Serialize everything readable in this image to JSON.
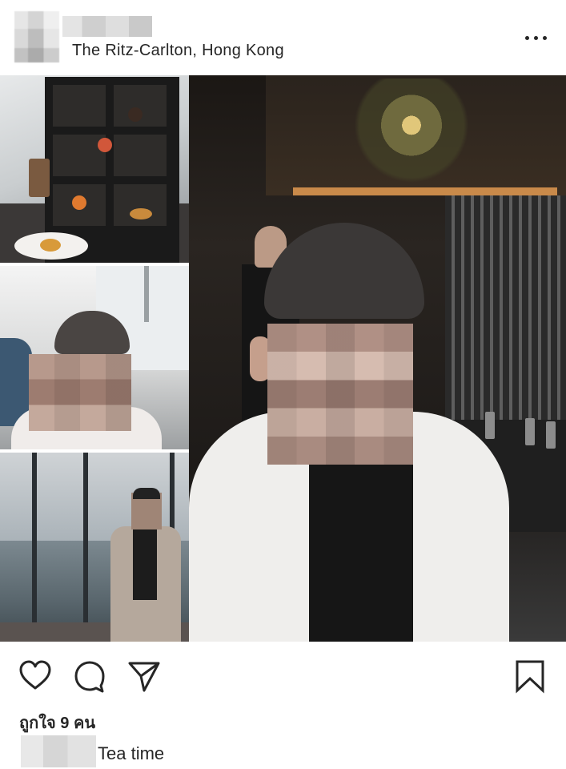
{
  "post": {
    "header": {
      "location": "The Ritz-Carlton, Hong Kong",
      "more_icon": "more-dots-icon"
    },
    "photos": [
      {
        "description_icon": "photo"
      },
      {
        "description_icon": "photo"
      },
      {
        "description_icon": "photo"
      },
      {
        "description_icon": "photo"
      }
    ],
    "actions": {
      "like_icon": "heart-icon",
      "comment_icon": "comment-icon",
      "share_icon": "send-icon",
      "save_icon": "bookmark-icon"
    },
    "likes_text": "ถูกใจ 9 คน",
    "caption": {
      "text": "Tea time"
    }
  },
  "colors": {
    "text": "#262626",
    "background": "#ffffff"
  }
}
